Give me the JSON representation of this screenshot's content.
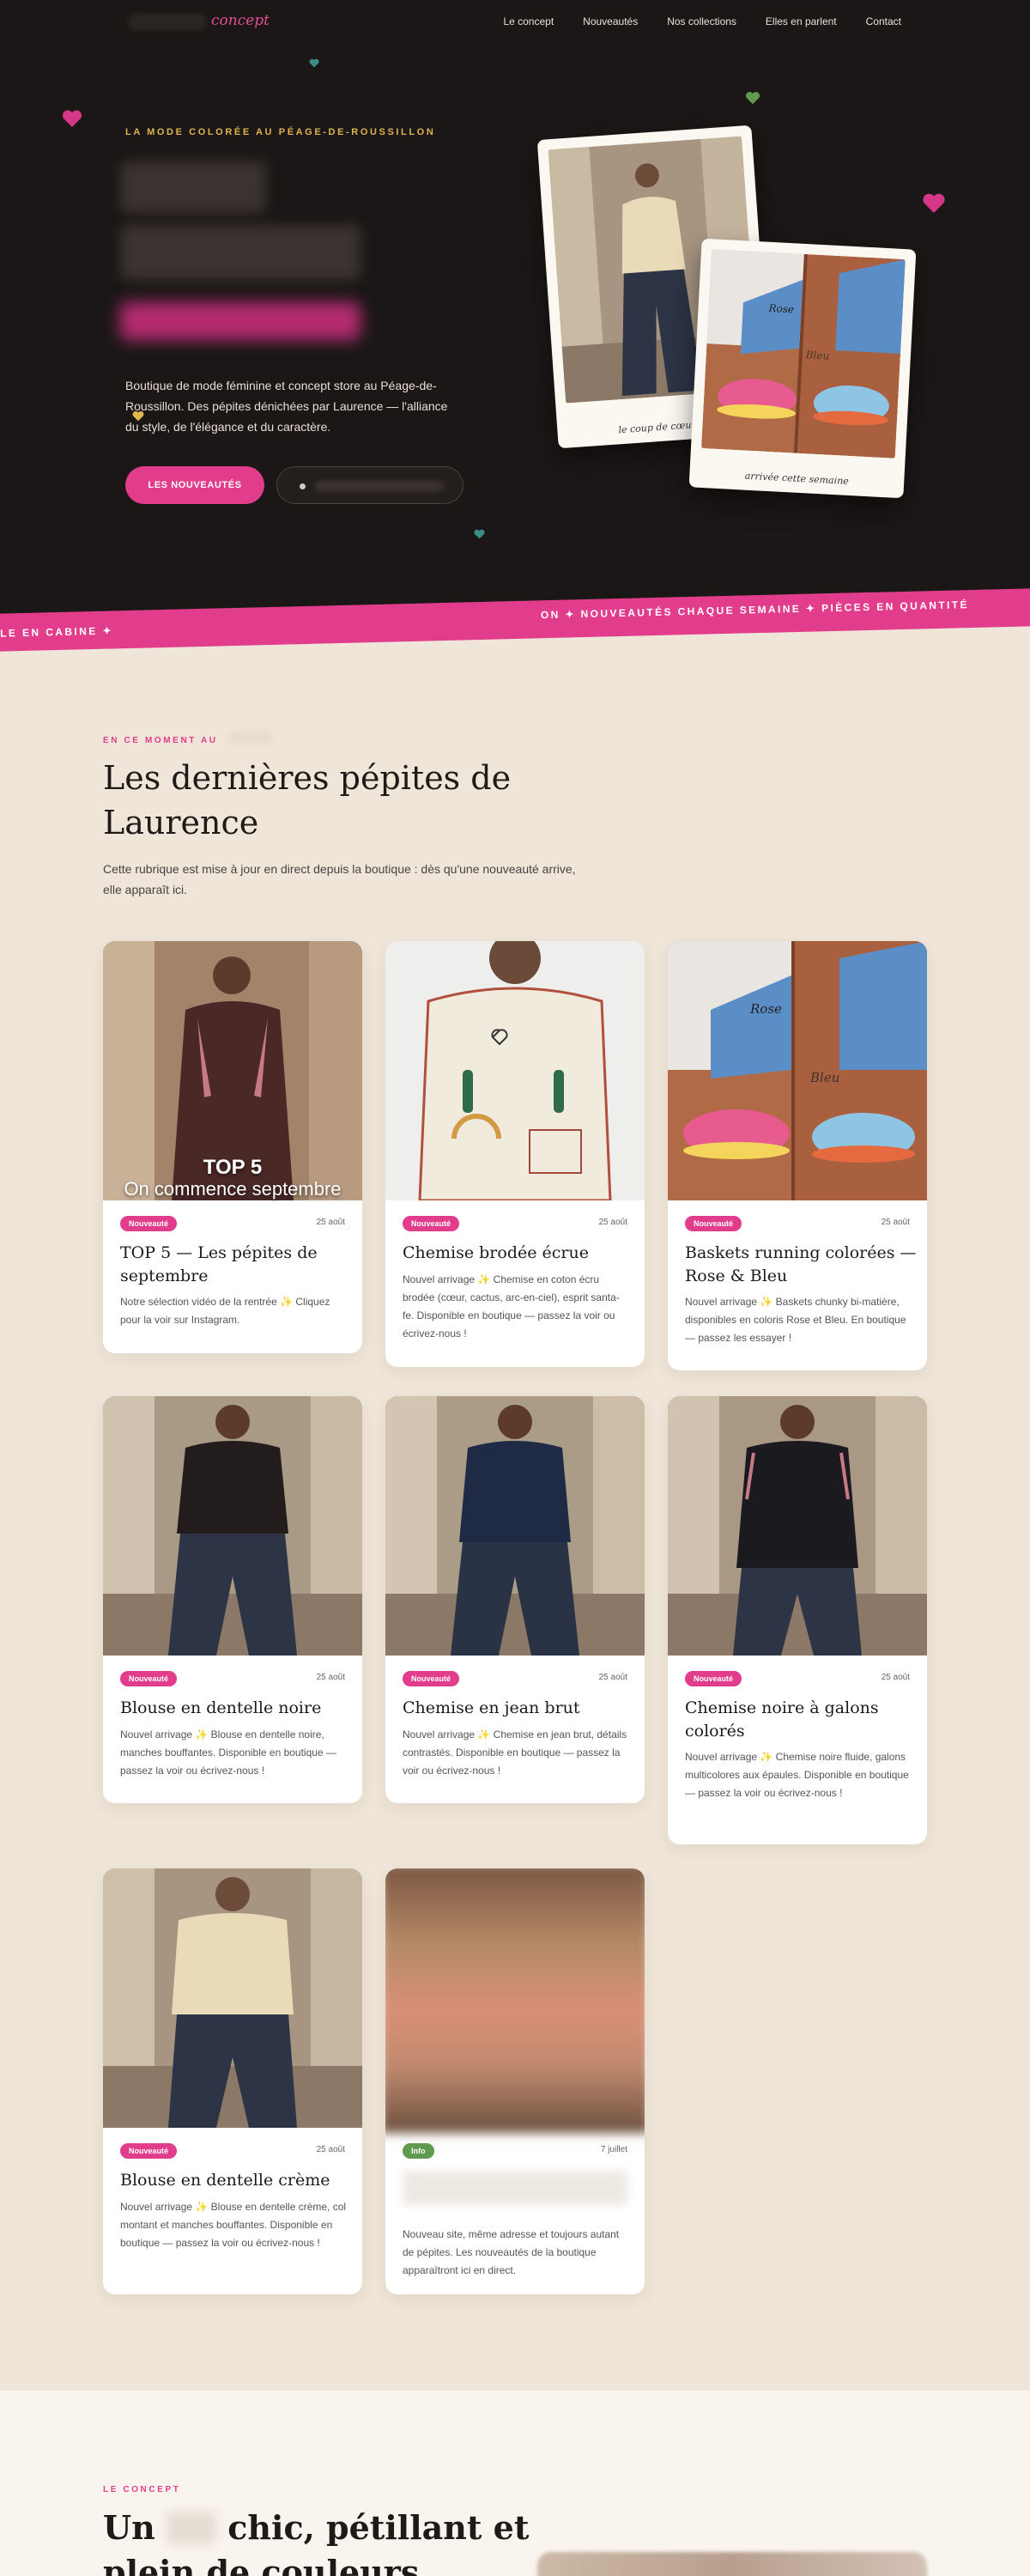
{
  "nav": {
    "logo_word": "concept",
    "links": [
      "Le concept",
      "Nouveautés",
      "Nos collections",
      "Elles en parlent",
      "Contact"
    ]
  },
  "hero": {
    "kicker": "LA MODE COLORÉE AU PÉAGE-DE-ROUSSILLON",
    "description": "Boutique de mode féminine et concept store au Péage-de-Roussillon. Des pépites dénichées par Laurence — l'alliance du style, de l'élégance et du caractère.",
    "cta_primary": "LES NOUVEAUTÉS",
    "polaroid_1_caption": "le coup de cœur du",
    "polaroid_2_caption": "arrivée cette semaine",
    "polaroid_2_labels": [
      "Rose",
      "Bleu"
    ]
  },
  "ticker": {
    "left": "LE EN CABINE   ✦",
    "right": "ON   ✦   NOUVEAUTÉS CHAQUE SEMAINE   ✦   PIÈCES EN QUANTITÉ"
  },
  "news": {
    "kicker": "EN CE MOMENT AU",
    "title": "Les dernières pépites de Laurence",
    "description": "Cette rubrique est mise à jour en direct depuis la boutique : dès qu'une nouveauté arrive, elle apparaît ici.",
    "cards": [
      {
        "badge": "Nouveauté",
        "date": "25 août",
        "title": "TOP 5 — Les pépites de septembre",
        "text": "Notre sélection vidéo de la rentrée ✨ Cliquez pour la voir sur Instagram.",
        "overlay": [
          "TOP 5",
          "On commence septembre"
        ]
      },
      {
        "badge": "Nouveauté",
        "date": "25 août",
        "title": "Chemise brodée écrue",
        "text": "Nouvel arrivage ✨ Chemise en coton écru brodée (cœur, cactus, arc-en-ciel), esprit santa-fe. Disponible en boutique — passez la voir ou écrivez-nous !"
      },
      {
        "badge": "Nouveauté",
        "date": "25 août",
        "title": "Baskets running colorées — Rose & Bleu",
        "text": "Nouvel arrivage ✨ Baskets chunky bi-matière, disponibles en coloris Rose et Bleu. En boutique — passez les essayer !",
        "labels": [
          "Rose",
          "Bleu"
        ]
      },
      {
        "badge": "Nouveauté",
        "date": "25 août",
        "title": "Blouse en dentelle noire",
        "text": "Nouvel arrivage ✨ Blouse en dentelle noire, manches bouffantes. Disponible en boutique — passez la voir ou écrivez-nous !"
      },
      {
        "badge": "Nouveauté",
        "date": "25 août",
        "title": "Chemise en jean brut",
        "text": "Nouvel arrivage ✨ Chemise en jean brut, détails contrastés. Disponible en boutique — passez la voir ou écrivez-nous !"
      },
      {
        "badge": "Nouveauté",
        "date": "25 août",
        "title": "Chemise noire à galons colorés",
        "text": "Nouvel arrivage ✨ Chemise noire fluide, galons multicolores aux épaules. Disponible en boutique — passez la voir ou écrivez-nous !"
      },
      {
        "badge": "Nouveauté",
        "date": "25 août",
        "title": "Blouse en dentelle crème",
        "text": "Nouvel arrivage ✨ Blouse en dentelle crème, col montant et manches bouffantes. Disponible en boutique — passez la voir ou écrivez-nous !"
      },
      {
        "badge": "Info",
        "date": "7 juillet",
        "text": "Nouveau site, même adresse et toujours autant de pépites. Les nouveautés de la boutique apparaîtront ici en direct."
      }
    ]
  },
  "concept": {
    "kicker": "LE CONCEPT",
    "title_start": "Un",
    "title_end": "chic, pétillant et plein de couleurs"
  },
  "colors": {
    "accent": "#e23c8c",
    "hero_bg": "#1b1716",
    "section_bg": "#efe5d8",
    "gold": "#e0b44e",
    "info_green": "#5f9a4e"
  }
}
